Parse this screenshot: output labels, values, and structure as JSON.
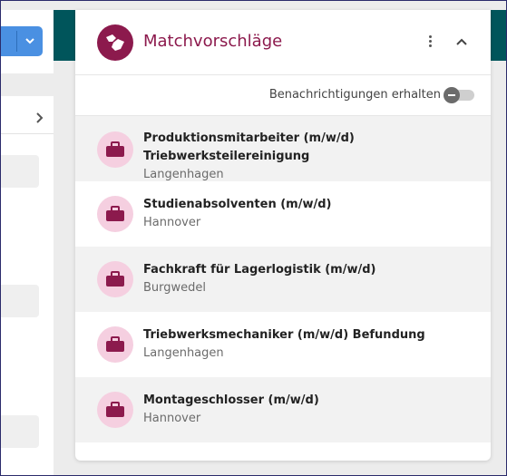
{
  "panel": {
    "title": "Matchvorschläge",
    "notifications_label": "Benachrichtigungen erhalten",
    "notifications_enabled": false
  },
  "icons": {
    "logo": "handshake-icon",
    "menu": "more-vertical-icon",
    "collapse": "chevron-up-icon",
    "job": "briefcase-icon",
    "toggle": "toggle-off-icon"
  },
  "colors": {
    "brand": "#8c1a4d",
    "brand_light": "#f5cfe0",
    "header_band": "#00555b",
    "accent_button": "#4a90e2"
  },
  "jobs": [
    {
      "title_line1": "Produktionsmitarbeiter (m/w/d)",
      "title_line2": "Triebwerksteilereinigung",
      "location": "Langenhagen"
    },
    {
      "title_line1": "Studienabsolventen (m/w/d)",
      "title_line2": "",
      "location": "Hannover"
    },
    {
      "title_line1": "Fachkraft für Lagerlogistik (m/w/d)",
      "title_line2": "",
      "location": "Burgwedel"
    },
    {
      "title_line1": "Triebwerksmechaniker (m/w/d) Befundung",
      "title_line2": "",
      "location": "Langenhagen"
    },
    {
      "title_line1": "Montageschlosser (m/w/d)",
      "title_line2": "",
      "location": "Hannover"
    }
  ]
}
